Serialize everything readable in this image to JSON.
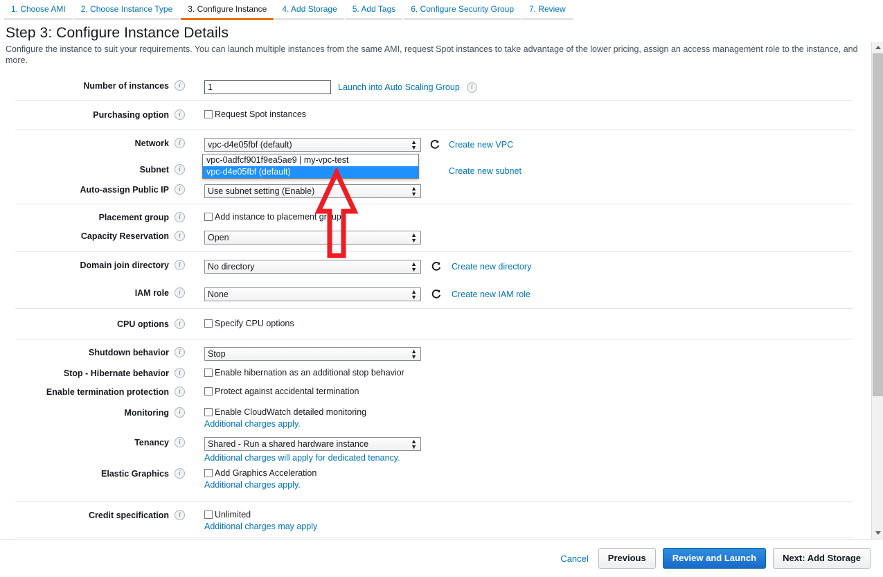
{
  "wizard": {
    "tabs": [
      {
        "label": "1. Choose AMI",
        "active": false
      },
      {
        "label": "2. Choose Instance Type",
        "active": false
      },
      {
        "label": "3. Configure Instance",
        "active": true
      },
      {
        "label": "4. Add Storage",
        "active": false
      },
      {
        "label": "5. Add Tags",
        "active": false
      },
      {
        "label": "6. Configure Security Group",
        "active": false
      },
      {
        "label": "7. Review",
        "active": false
      }
    ]
  },
  "page": {
    "title": "Step 3: Configure Instance Details",
    "description": "Configure the instance to suit your requirements. You can launch multiple instances from the same AMI, request Spot instances to take advantage of the lower pricing, assign an access management role to the instance, and more."
  },
  "form": {
    "number_of_instances": {
      "label": "Number of instances",
      "value": "1",
      "link": "Launch into Auto Scaling Group"
    },
    "purchasing_option": {
      "label": "Purchasing option",
      "checkbox_label": "Request Spot instances",
      "checked": false
    },
    "network": {
      "label": "Network",
      "value": "vpc-d4e05fbf (default)",
      "link": "Create new VPC",
      "open": true,
      "options": [
        {
          "label": "vpc-0adfcf901f9ea5ae9 | my-vpc-test",
          "selected": false
        },
        {
          "label": "vpc-d4e05fbf (default)",
          "selected": true
        }
      ]
    },
    "subnet": {
      "label": "Subnet",
      "link": "Create new subnet"
    },
    "auto_assign_public_ip": {
      "label": "Auto-assign Public IP",
      "value": "Use subnet setting (Enable)"
    },
    "placement_group": {
      "label": "Placement group",
      "checkbox_label": "Add instance to placement group",
      "checked": false
    },
    "capacity_reservation": {
      "label": "Capacity Reservation",
      "value": "Open"
    },
    "domain_join_directory": {
      "label": "Domain join directory",
      "value": "No directory",
      "link": "Create new directory"
    },
    "iam_role": {
      "label": "IAM role",
      "value": "None",
      "link": "Create new IAM role"
    },
    "cpu_options": {
      "label": "CPU options",
      "checkbox_label": "Specify CPU options",
      "checked": false
    },
    "shutdown_behavior": {
      "label": "Shutdown behavior",
      "value": "Stop"
    },
    "hibernate_behavior": {
      "label": "Stop - Hibernate behavior",
      "checkbox_label": "Enable hibernation as an additional stop behavior",
      "checked": false
    },
    "termination_protection": {
      "label": "Enable termination protection",
      "checkbox_label": "Protect against accidental termination",
      "checked": false
    },
    "monitoring": {
      "label": "Monitoring",
      "checkbox_label": "Enable CloudWatch detailed monitoring",
      "note": "Additional charges apply.",
      "checked": false
    },
    "tenancy": {
      "label": "Tenancy",
      "value": "Shared - Run a shared hardware instance",
      "note": "Additional charges will apply for dedicated tenancy."
    },
    "elastic_graphics": {
      "label": "Elastic Graphics",
      "checkbox_label": "Add Graphics Acceleration",
      "note": "Additional charges apply.",
      "checked": false
    },
    "credit_specification": {
      "label": "Credit specification",
      "checkbox_label": "Unlimited",
      "note": "Additional charges may apply",
      "checked": false
    }
  },
  "footer": {
    "cancel": "Cancel",
    "previous": "Previous",
    "review_and_launch": "Review and Launch",
    "next": "Next: Add Storage"
  },
  "annotation": {
    "arrow_color": "#ee1c25",
    "shape": "up-arrow-outline"
  },
  "colors": {
    "link": "#0073bb",
    "active_tab_underline": "#ec7211",
    "primary_button": "#1869c8",
    "dropdown_selected": "#1e90ff"
  }
}
